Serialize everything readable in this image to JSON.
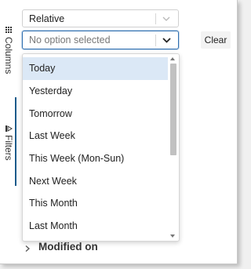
{
  "rail": {
    "columns_label": "Columns",
    "filters_label": "Filters"
  },
  "relative_select": {
    "value": "Relative"
  },
  "date_select": {
    "placeholder": "No option selected"
  },
  "clear_button": {
    "label": "Clear"
  },
  "menu": {
    "items": [
      {
        "label": "Today"
      },
      {
        "label": "Yesterday"
      },
      {
        "label": "Tomorrow"
      },
      {
        "label": "Last Week"
      },
      {
        "label": "This Week (Mon-Sun)"
      },
      {
        "label": "Next Week"
      },
      {
        "label": "This Month"
      },
      {
        "label": "Last Month"
      }
    ],
    "highlighted": "Today"
  },
  "modified_on": {
    "label": "Modified on"
  },
  "colors": {
    "accent": "#2f6fb0",
    "highlight": "#dbe8f6",
    "filters_bar": "#1a5a8a"
  }
}
